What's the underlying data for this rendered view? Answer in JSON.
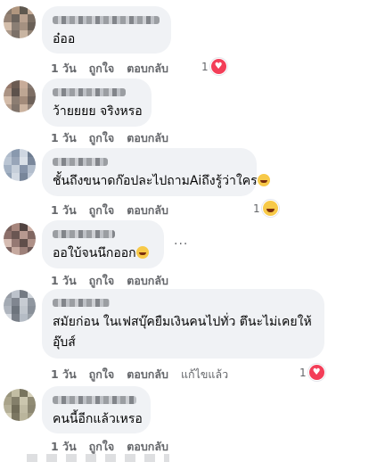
{
  "comments": [
    {
      "text": "อ๋ออ",
      "time": "1 วัน",
      "like": "ถูกใจ",
      "reply": "ตอบกลับ",
      "reaction": {
        "count": "1",
        "type": "heart-icon"
      },
      "avatar_colors": [
        "#7b6a5c",
        "#a88b72",
        "#4e463d",
        "#c2a690",
        "#8a7566",
        "#5d544c",
        "#b39985",
        "#6b5e52",
        "#d0b8a2",
        "#7e7166",
        "#9c8674",
        "#5a4f45",
        "#a38f7e",
        "#6e6258",
        "#c4ae99",
        "#857464"
      ]
    },
    {
      "text": "ว้ายยยย จริงหรอ",
      "time": "1 วัน",
      "like": "ถูกใจ",
      "reply": "ตอบกลับ",
      "avatar_colors": [
        "#8a6a5a",
        "#5b4a40",
        "#c3a48f",
        "#7a6b62",
        "#a28876",
        "#4c4039",
        "#b89d88",
        "#6f5f54",
        "#d0b5a0",
        "#806f63",
        "#9a7f6c",
        "#5e5048",
        "#ad9481",
        "#74655b",
        "#c6ab96",
        "#8b7a6d"
      ]
    },
    {
      "text": "ชั้นถึงขนาดก๊อปละไปถามAiถึงรู้ว่าใคร",
      "time": "1 วัน",
      "like": "ถูกใจ",
      "reply": "ตอบกลับ",
      "reaction": {
        "count": "1",
        "type": "laughing-face-icon"
      },
      "avatar_colors": [
        "#a7b4c6",
        "#7d8ea6",
        "#c9d2de",
        "#5f6f86",
        "#b3bfcf",
        "#8d9cb1",
        "#d6dde6",
        "#6c7b91",
        "#9aa9bd",
        "#c0cad7",
        "#7888a0",
        "#aab6c7",
        "#8697ad",
        "#cfd7e1",
        "#6a7990",
        "#b8c3d2"
      ]
    },
    {
      "text": "ออใบ้จนนึกออก",
      "time": "1 วัน",
      "like": "ถูกใจ",
      "reply": "ตอบกลับ",
      "more": "···",
      "avatar_colors": [
        "#6b4f4a",
        "#9e7a70",
        "#3f2f2c",
        "#c7a79c",
        "#80605a",
        "#5a4440",
        "#b08e84",
        "#735651",
        "#d2b5aa",
        "#8a6b64",
        "#4f3b37",
        "#a6857b",
        "#6e534e",
        "#c0a095",
        "#93736b",
        "#5e4743"
      ]
    },
    {
      "text_line1": "สมัยก่อน ในเฟสบุ๊คยืมเงินคนไปทั่ว ตึนะไม่เคยให้",
      "text_line2": "อุ๊บส์",
      "time": "1 วัน",
      "like": "ถูกใจ",
      "reply": "ตอบกลับ",
      "edited": "แก้ไขแล้ว",
      "reaction": {
        "count": "1",
        "type": "heart-icon"
      },
      "avatar_colors": [
        "#8b929c",
        "#b5bcc6",
        "#656c76",
        "#cdd2d9",
        "#9aa1ab",
        "#737a84",
        "#c1c7cf",
        "#858c96",
        "#a7aeb8",
        "#5e656f",
        "#bac0c8",
        "#7d848e",
        "#d3d8de",
        "#6b727c",
        "#aeb5bf",
        "#90979f"
      ]
    },
    {
      "text": "คนนี้อีกแล้วเหรอ",
      "time": "1 วัน",
      "like": "ถูกใจ",
      "reply": "ตอบกลับ",
      "avatar_colors": [
        "#8f8a6e",
        "#bcb69a",
        "#6a654d",
        "#d1cbb2",
        "#a09a7e",
        "#77725a",
        "#c6c0a6",
        "#857f66",
        "#aea88d",
        "#625d47",
        "#bab49a",
        "#7f7a62",
        "#cfc9b0",
        "#6e6952",
        "#b3ad92",
        "#948f74"
      ]
    }
  ]
}
